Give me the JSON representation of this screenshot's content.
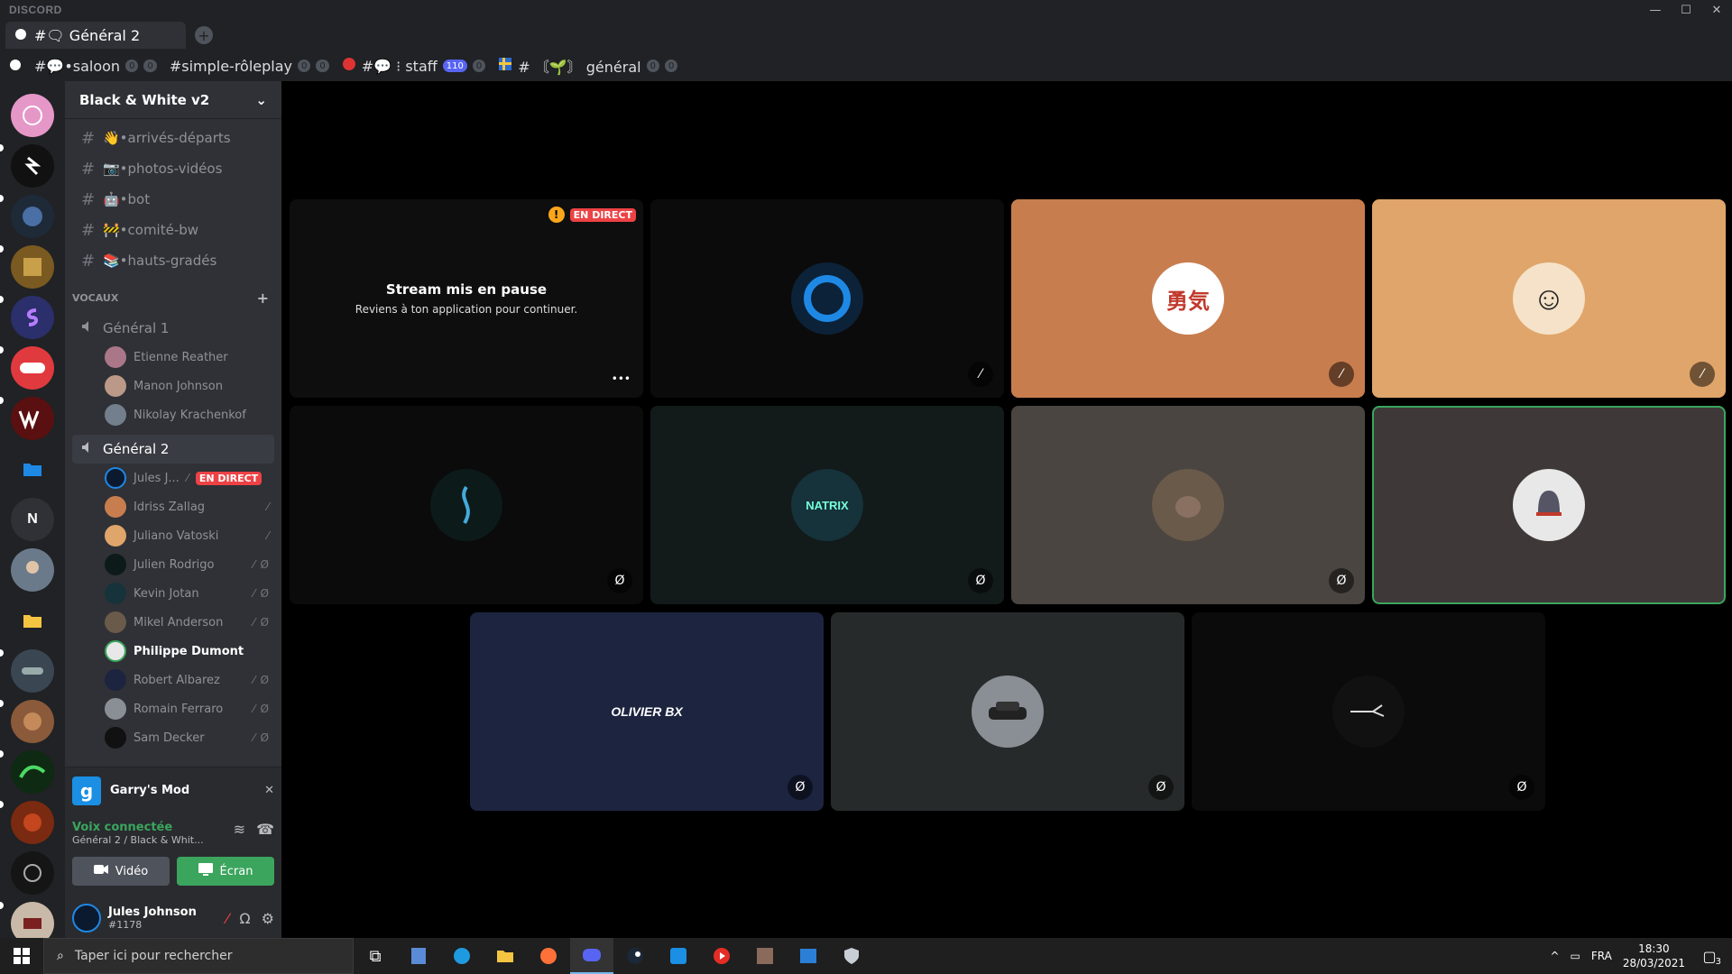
{
  "window": {
    "brand": "DISCORD",
    "controls": [
      "—",
      "☐",
      "✕"
    ]
  },
  "tab": {
    "label": "#🗨 Général 2",
    "add": "+"
  },
  "channels_bar": [
    {
      "label": "#💬•saloon",
      "counts": [
        "0",
        "0"
      ]
    },
    {
      "label": "#simple-rôleplay",
      "counts": [
        "0",
        "0"
      ]
    },
    {
      "label": "#💬 ⁝ staff",
      "counts": [
        "110",
        "0"
      ]
    },
    {
      "label": "# 〘🌱〙 général",
      "counts": [
        "0",
        "0"
      ]
    }
  ],
  "server": {
    "name": "Black & White v2",
    "chevron": "⌄"
  },
  "text_channels": [
    {
      "label": "👋•arrivés-départs"
    },
    {
      "label": "📷•photos-vidéos"
    },
    {
      "label": "🤖•bot"
    },
    {
      "label": "🚧•comité-bw"
    },
    {
      "label": "📚•hauts-gradés"
    }
  ],
  "voice_category": {
    "label": "VOCAUX",
    "add": "+"
  },
  "voice_channel_1": {
    "label": "Général 1",
    "users": [
      {
        "name": "Etienne Reather"
      },
      {
        "name": "Manon Johnson"
      },
      {
        "name": "Nikolay Krachenkof"
      }
    ]
  },
  "voice_channel_2": {
    "label": "Général 2",
    "users": [
      {
        "name": "Jules J...",
        "live": "EN DIRECT"
      },
      {
        "name": "Idriss Zallag"
      },
      {
        "name": "Juliano Vatoski"
      },
      {
        "name": "Julien Rodrigo"
      },
      {
        "name": "Kevin Jotan"
      },
      {
        "name": "Mikel Anderson"
      },
      {
        "name": "Philippe Dumont"
      },
      {
        "name": "Robert Albarez"
      },
      {
        "name": "Romain Ferraro"
      },
      {
        "name": "Sam Decker"
      }
    ]
  },
  "activity": {
    "game": "Garry's Mod"
  },
  "voice_panel": {
    "title": "Voix connectée",
    "subtitle": "Général 2 / Black & Whit...",
    "video_label": "Vidéo",
    "screen_label": "Écran"
  },
  "user": {
    "name": "Jules Johnson",
    "tag": "#1178"
  },
  "stream_tile": {
    "badge": "EN DIRECT",
    "title": "Stream mis en pause",
    "subtitle": "Reviens à ton application pour continuer.",
    "menu": "•••"
  },
  "tiles": [
    {
      "text": "",
      "bg": "#0b0b0b",
      "avatar_bg": "#0c2238"
    },
    {
      "text": "勇気",
      "bg": "#c87d4e",
      "avatar_bg": "#ffffff"
    },
    {
      "text": "☺",
      "bg": "#e0a56a",
      "avatar_bg": "#f5e2c8"
    },
    {
      "text": "",
      "bg": "#0b0b0b",
      "avatar_bg": "#0d1a1a"
    },
    {
      "text": "NATRIX",
      "bg": "#121a1a",
      "avatar_bg": "#16323a"
    },
    {
      "text": "",
      "bg": "#4a4540",
      "avatar_bg": "#6a5a4a"
    },
    {
      "text": "",
      "bg": "#3f3839",
      "avatar_bg": "#e8e8e8"
    },
    {
      "text": "OLIVIER BX",
      "bg": "#1d2440",
      "avatar_bg": "#1d2440"
    },
    {
      "text": "",
      "bg": "#272a2a",
      "avatar_bg": "#8a8f95"
    },
    {
      "text": "",
      "bg": "#0b0b0b",
      "avatar_bg": "#111111"
    }
  ],
  "taskbar": {
    "search_placeholder": "Taper ici pour rechercher",
    "lang": "FRA",
    "time": "18:30",
    "date": "28/03/2021",
    "notifications": "3"
  },
  "colors": {
    "accent_green": "#3ba55d",
    "live_red": "#ed4245",
    "blurple": "#5865f2"
  }
}
